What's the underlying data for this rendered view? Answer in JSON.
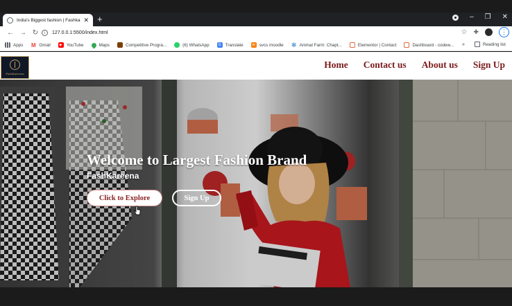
{
  "browser": {
    "tab_title": "India's Biggest fashion | Fashkare...",
    "url": "127.0.0.1:5500/index.html",
    "bookmarks": [
      {
        "label": "Apps",
        "icon": "apps-grid-icon",
        "color": "#5f6368"
      },
      {
        "label": "Gmail",
        "icon": "gmail-icon",
        "color": "#ea4335"
      },
      {
        "label": "YouTube",
        "icon": "youtube-icon",
        "color": "#ff0000"
      },
      {
        "label": "Maps",
        "icon": "maps-pin-icon",
        "color": "#34a853"
      },
      {
        "label": "Competitive Progra...",
        "icon": "bookmark-favicon-icon",
        "color": "#7b3f00"
      },
      {
        "label": "(6) WhatsApp",
        "icon": "whatsapp-icon",
        "color": "#25d366"
      },
      {
        "label": "Translate",
        "icon": "translate-icon",
        "color": "#4285f4"
      },
      {
        "label": "svcs moodle",
        "icon": "moodle-icon",
        "color": "#f98012"
      },
      {
        "label": "Animal Farm: Chapt...",
        "icon": "snowflake-icon",
        "color": "#2a7fc4"
      },
      {
        "label": "Elementor | Contact",
        "icon": "elementor-icon",
        "color": "#e2693b"
      },
      {
        "label": "Dashboard - codew...",
        "icon": "codewars-icon",
        "color": "#e2693b"
      }
    ],
    "more_label": "»",
    "reading_list": "Reading list"
  },
  "site": {
    "logo_text": "FashKareena",
    "nav": [
      "Home",
      "Contact us",
      "About us",
      "Sign Up"
    ],
    "hero_title": "Welcome to Largest Fashion Brand",
    "hero_subtitle": "FashKareena",
    "cta_primary": "Click to Explore",
    "cta_secondary": "Sign Up"
  },
  "colors": {
    "brand_maroon": "#7a1a1a",
    "logo_navy": "#101726",
    "logo_gold": "#bfa063",
    "browser_dark": "#202124"
  }
}
